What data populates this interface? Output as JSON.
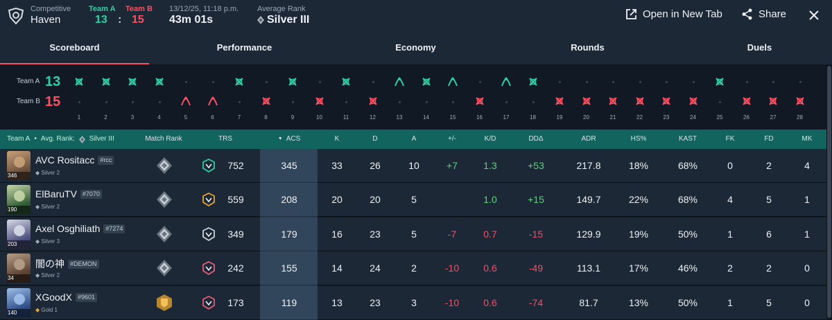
{
  "header": {
    "mode_label": "Competitive",
    "map": "Haven",
    "team_a_label": "Team A",
    "team_b_label": "Team B",
    "team_a_score": "13",
    "score_sep": ":",
    "team_b_score": "15",
    "date": "13/12/25, 11:18 p.m.",
    "duration": "43m 01s",
    "avg_rank_label": "Average Rank",
    "avg_rank": "Silver III",
    "open_tab_label": "Open in New Tab",
    "share_label": "Share"
  },
  "tabs": [
    "Scoreboard",
    "Performance",
    "Economy",
    "Rounds",
    "Duels"
  ],
  "active_tab": "Scoreboard",
  "rounds": {
    "team_a_label": "Team A",
    "team_b_label": "Team B",
    "team_a_score": "13",
    "team_b_score": "15",
    "results": [
      "A-elim",
      "A-elim",
      "A-elim",
      "A-elim",
      "B-defuse",
      "B-defuse",
      "A-elim",
      "B-elim",
      "A-elim",
      "B-elim",
      "A-elim",
      "B-elim",
      "A-defuse",
      "A-elim",
      "A-defuse",
      "B-elim",
      "A-defuse",
      "A-elim",
      "B-elim",
      "B-elim",
      "B-elim",
      "B-elim",
      "B-elim",
      "B-elim",
      "A-elim",
      "B-elim",
      "B-elim",
      "B-elim"
    ],
    "numbers": [
      "1",
      "2",
      "3",
      "4",
      "5",
      "6",
      "7",
      "8",
      "9",
      "10",
      "11",
      "12",
      "13",
      "14",
      "15",
      "16",
      "17",
      "18",
      "19",
      "20",
      "21",
      "22",
      "23",
      "24",
      "25",
      "26",
      "27",
      "28"
    ]
  },
  "table": {
    "team_label": "Team A",
    "avg_rank_label": "Avg. Rank:",
    "avg_rank": "Silver III",
    "columns": [
      "Match Rank",
      "TRS",
      "ACS",
      "K",
      "D",
      "A",
      "+/-",
      "K/D",
      "DDΔ",
      "ADR",
      "HS%",
      "KAST",
      "FK",
      "FD",
      "MK"
    ],
    "sort_indicator": "▼",
    "players": [
      {
        "level": "346",
        "name": "AVC Rositacc",
        "tag": "#rcc",
        "rank": "Silver 2",
        "trs": "752",
        "acs": "345",
        "k": "33",
        "d": "26",
        "a": "10",
        "pm": "+7",
        "kd": "1.3",
        "dd": "+53",
        "adr": "217.8",
        "hs": "18%",
        "kast": "68%",
        "fk": "0",
        "fd": "2",
        "mk": "4",
        "trs_color": "#2fd1a5",
        "rank_color": "#9eabb8"
      },
      {
        "level": "190",
        "name": "ElBaruTV",
        "tag": "#7070",
        "rank": "Silver 2",
        "trs": "559",
        "acs": "208",
        "k": "20",
        "d": "20",
        "a": "5",
        "pm": "",
        "kd": "1.0",
        "dd": "+15",
        "adr": "149.7",
        "hs": "22%",
        "kast": "68%",
        "fk": "4",
        "fd": "5",
        "mk": "1",
        "trs_color": "#e0a43a",
        "rank_color": "#9eabb8"
      },
      {
        "level": "203",
        "name": "Axel Osghiliath",
        "tag": "#7274",
        "rank": "Silver 3",
        "trs": "349",
        "acs": "179",
        "k": "16",
        "d": "23",
        "a": "5",
        "pm": "-7",
        "kd": "0.7",
        "dd": "-15",
        "adr": "129.9",
        "hs": "19%",
        "kast": "50%",
        "fk": "1",
        "fd": "6",
        "mk": "1",
        "trs_color": "#c9d3dc",
        "rank_color": "#9eabb8"
      },
      {
        "level": "34",
        "name": "闇の神",
        "tag": "#DEMON",
        "rank": "Silver 2",
        "trs": "242",
        "acs": "155",
        "k": "14",
        "d": "24",
        "a": "2",
        "pm": "-10",
        "kd": "0.6",
        "dd": "-49",
        "adr": "113.1",
        "hs": "17%",
        "kast": "46%",
        "fk": "2",
        "fd": "2",
        "mk": "0",
        "trs_color": "#e65c7a",
        "rank_color": "#9eabb8"
      },
      {
        "level": "140",
        "name": "XGoodX",
        "tag": "#9601",
        "rank": "Gold 1",
        "trs": "173",
        "acs": "119",
        "k": "13",
        "d": "23",
        "a": "3",
        "pm": "-10",
        "kd": "0.6",
        "dd": "-74",
        "adr": "81.7",
        "hs": "13%",
        "kast": "50%",
        "fk": "1",
        "fd": "5",
        "mk": "0",
        "trs_color": "#e65c7a",
        "rank_color": "#e0a43a"
      }
    ]
  },
  "colors": {
    "team_a": "#2fd1a5",
    "team_b": "#ff4f61",
    "positive": "#58d67a",
    "negative": "#f0526a",
    "header_bg": "#1c2836",
    "table_head_bg": "#12655e"
  }
}
